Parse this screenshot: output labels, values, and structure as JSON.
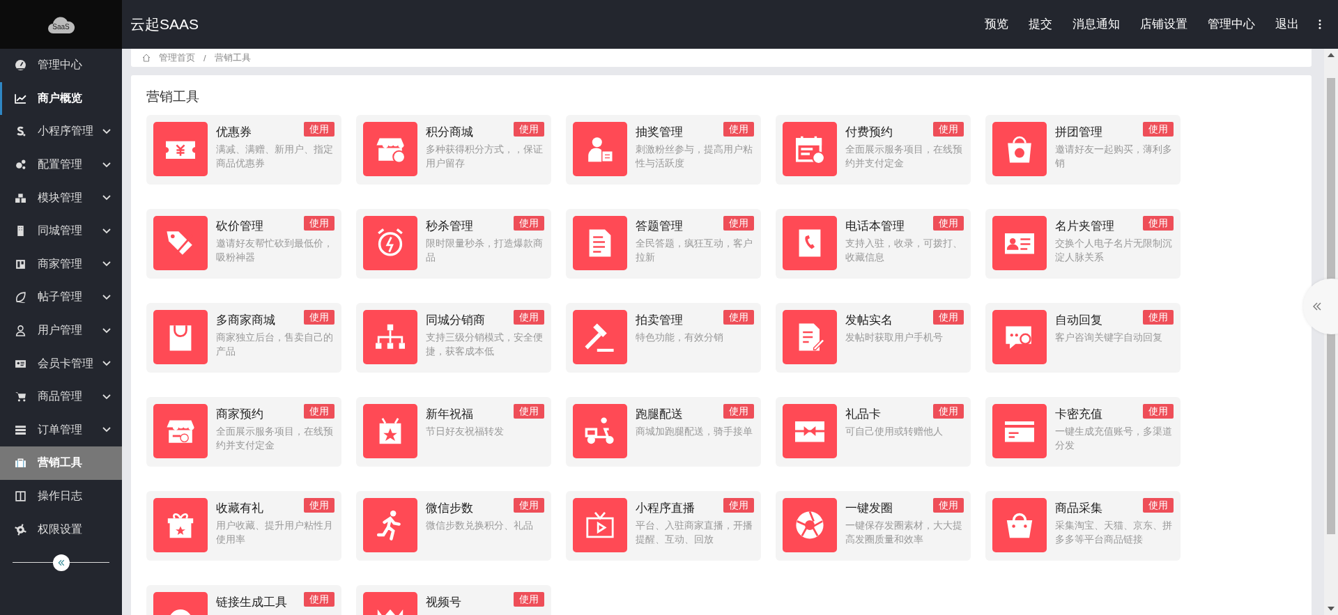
{
  "sidebar": {
    "logo": "SaaS",
    "items": [
      {
        "label": "管理中心",
        "has_submenu": false,
        "highlighted": false,
        "selected": false
      },
      {
        "label": "商户概览",
        "has_submenu": false,
        "highlighted": true,
        "selected": false
      },
      {
        "label": "小程序管理",
        "has_submenu": true,
        "highlighted": false,
        "selected": false
      },
      {
        "label": "配置管理",
        "has_submenu": true,
        "highlighted": false,
        "selected": false
      },
      {
        "label": "模块管理",
        "has_submenu": true,
        "highlighted": false,
        "selected": false
      },
      {
        "label": "同城管理",
        "has_submenu": true,
        "highlighted": false,
        "selected": false
      },
      {
        "label": "商家管理",
        "has_submenu": true,
        "highlighted": false,
        "selected": false
      },
      {
        "label": "帖子管理",
        "has_submenu": true,
        "highlighted": false,
        "selected": false
      },
      {
        "label": "用户管理",
        "has_submenu": true,
        "highlighted": false,
        "selected": false
      },
      {
        "label": "会员卡管理",
        "has_submenu": true,
        "highlighted": false,
        "selected": false
      },
      {
        "label": "商品管理",
        "has_submenu": true,
        "highlighted": false,
        "selected": false
      },
      {
        "label": "订单管理",
        "has_submenu": true,
        "highlighted": false,
        "selected": false
      },
      {
        "label": "营销工具",
        "has_submenu": false,
        "highlighted": false,
        "selected": true
      },
      {
        "label": "操作日志",
        "has_submenu": false,
        "highlighted": false,
        "selected": false
      },
      {
        "label": "权限设置",
        "has_submenu": false,
        "highlighted": false,
        "selected": false
      }
    ]
  },
  "topbar": {
    "title": "云起SAAS",
    "menu": [
      "预览",
      "提交",
      "消息通知",
      "店铺设置",
      "管理中心",
      "退出"
    ]
  },
  "breadcrumb": [
    "管理首页",
    "/",
    "营销工具"
  ],
  "panel": {
    "title": "营销工具",
    "tools": [
      {
        "name": "优惠券",
        "action": "使用",
        "description": "满减、满赠、新用户、指定商品优惠券"
      },
      {
        "name": "积分商城",
        "action": "使用",
        "description": "多种获得积分方式，，保证用户留存"
      },
      {
        "name": "抽奖管理",
        "action": "使用",
        "description": "刺激粉丝参与，提高用户粘性与活跃度"
      },
      {
        "name": "付费预约",
        "action": "使用",
        "description": "全面展示服务项目，在线预约并支付定金"
      },
      {
        "name": "拼团管理",
        "action": "使用",
        "description": "邀请好友一起购买，薄利多销"
      },
      {
        "name": "砍价管理",
        "action": "使用",
        "description": "邀请好友帮忙砍到最低价，吸粉神器"
      },
      {
        "name": "秒杀管理",
        "action": "使用",
        "description": "限时限量秒杀，打造爆款商品"
      },
      {
        "name": "答题管理",
        "action": "使用",
        "description": "全民答题，疯狂互动，客户拉新"
      },
      {
        "name": "电话本管理",
        "action": "使用",
        "description": "支持入驻，收录，可拨打、收藏信息"
      },
      {
        "name": "名片夹管理",
        "action": "使用",
        "description": "交换个人电子名片无限制沉淀人脉关系"
      },
      {
        "name": "多商家商城",
        "action": "使用",
        "description": "商家独立后台，售卖自己的产品"
      },
      {
        "name": "同城分销商",
        "action": "使用",
        "description": "支持三级分销模式，安全便捷，获客成本低"
      },
      {
        "name": "拍卖管理",
        "action": "使用",
        "description": "特色功能，有效分销"
      },
      {
        "name": "发帖实名",
        "action": "使用",
        "description": "发帖时获取用户手机号"
      },
      {
        "name": "自动回复",
        "action": "使用",
        "description": "客户咨询关键字自动回复"
      },
      {
        "name": "商家预约",
        "action": "使用",
        "description": "全面展示服务项目，在线预约并支付定金"
      },
      {
        "name": "新年祝福",
        "action": "使用",
        "description": "节日好友祝福转发"
      },
      {
        "name": "跑腿配送",
        "action": "使用",
        "description": "商城加跑腿配送，骑手接单"
      },
      {
        "name": "礼品卡",
        "action": "使用",
        "description": "可自己使用或转赠他人"
      },
      {
        "name": "卡密充值",
        "action": "使用",
        "description": "一键生成充值账号，多渠道分发"
      },
      {
        "name": "收藏有礼",
        "action": "使用",
        "description": "用户收藏、提升用户粘性月使用率"
      },
      {
        "name": "微信步数",
        "action": "使用",
        "description": "微信步数兑换积分、礼品"
      },
      {
        "name": "小程序直播",
        "action": "使用",
        "description": "平台、入驻商家直播，开播提醒、互动、回放"
      },
      {
        "name": "一键发圈",
        "action": "使用",
        "description": "一键保存发圈素材，大大提高发圈质量和效率"
      },
      {
        "name": "商品采集",
        "action": "使用",
        "description": "采集淘宝、天猫、京东、拼多多等平台商品链接"
      },
      {
        "name": "链接生成工具",
        "action": "使用"
      },
      {
        "name": "视频号",
        "action": "使用"
      }
    ]
  }
}
